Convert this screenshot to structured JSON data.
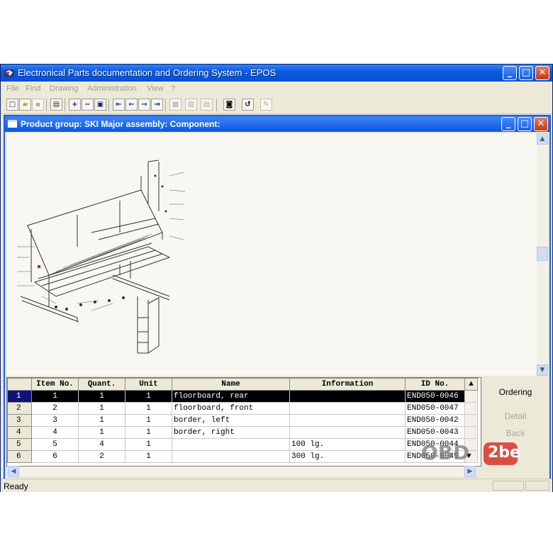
{
  "window": {
    "title": "Electronical Parts documentation and Ordering System - EPOS",
    "minimize": "_",
    "maximize": "□",
    "close": "✕"
  },
  "menu": [
    "File",
    "Find",
    "Drawing",
    "Administration",
    "View",
    "?"
  ],
  "child": {
    "title": "Product group: SKI  Major assembly:  Component:"
  },
  "grid": {
    "columns": [
      "",
      "Item No.",
      "Quant.",
      "Unit",
      "Name",
      "Information",
      "ID No."
    ],
    "rows": [
      {
        "row": "1",
        "item": "1",
        "quant": "1",
        "unit": "1",
        "name": "floorboard, rear",
        "info": "",
        "id": "END050-0046"
      },
      {
        "row": "2",
        "item": "2",
        "quant": "1",
        "unit": "1",
        "name": "floorboard, front",
        "info": "",
        "id": "END050-0047"
      },
      {
        "row": "3",
        "item": "3",
        "quant": "1",
        "unit": "1",
        "name": "border, left",
        "info": "",
        "id": "END050-0042"
      },
      {
        "row": "4",
        "item": "4",
        "quant": "1",
        "unit": "1",
        "name": "border, right",
        "info": "",
        "id": "END050-0043"
      },
      {
        "row": "5",
        "item": "5",
        "quant": "4",
        "unit": "1",
        "name": "",
        "info": "100 lg.",
        "id": "END050-0044"
      },
      {
        "row": "6",
        "item": "6",
        "quant": "2",
        "unit": "1",
        "name": "",
        "info": "300 lg.",
        "id": "END050-0045"
      }
    ],
    "selected_row": 1
  },
  "side_buttons": {
    "ordering": "Ordering",
    "detail": "Detail",
    "back": "Back"
  },
  "status": {
    "text": "Ready"
  },
  "watermark": {
    "text_a": "OBD",
    "text_b": "2be"
  },
  "colors": {
    "title_blue": "#0a5ce0",
    "selected_row": "#000000",
    "window_bg": "#ece9d8"
  }
}
